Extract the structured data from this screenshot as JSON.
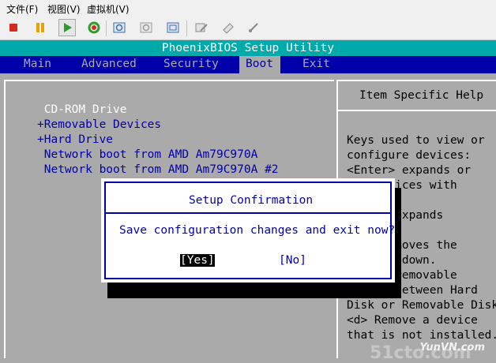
{
  "menu": [
    "文件(F)",
    "视图(V)",
    "虚拟机(V)"
  ],
  "toolbar_icons": [
    "stop-icon",
    "pause-icon",
    "play-icon",
    "reset-icon",
    "snapshot-icon",
    "revert-snapshot-icon",
    "manage-snapshots-icon",
    "edit-settings-icon",
    "connect-icon",
    "usb-icon"
  ],
  "bios": {
    "title": "PhoenixBIOS Setup Utility",
    "tabs": [
      "Main",
      "Advanced",
      "Security",
      "Boot",
      "Exit"
    ],
    "selected_tab": "Boot",
    "boot_items": [
      " CD-ROM Drive",
      "+Removable Devices",
      "+Hard Drive",
      " Network boot from AMD Am79C970A",
      " Network boot from AMD Am79C970A #2"
    ],
    "help_title": "Item Specific Help",
    "help_lines": [
      "Keys used to view or",
      "configure devices:",
      "<Enter> expands or",
      "  s devices with",
      "",
      "   er> expands",
      "",
      "   <-> moves the",
      "   p or down.",
      "   ove removable",
      "device between Hard",
      "Disk or Removable Disk",
      "<d> Remove a device",
      "that is not installed."
    ]
  },
  "dialog": {
    "title": "Setup Confirmation",
    "message": "Save configuration changes and exit now?",
    "yes": "[Yes]",
    "no": "[No]"
  },
  "colors": {
    "bios_bg": "#aaaaaa",
    "title_bar": "#00aaaa",
    "tab_bar": "#0000aa",
    "text_blue": "#0000aa"
  },
  "watermark": {
    "main": "51cto.com",
    "sub": "YunVN.com"
  }
}
